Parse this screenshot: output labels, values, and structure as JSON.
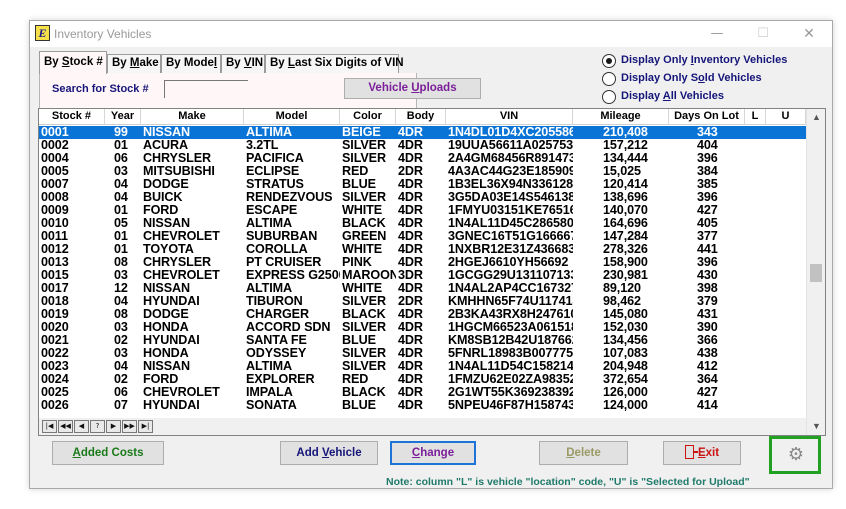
{
  "window": {
    "title": "Inventory Vehicles",
    "controls": {
      "minimize": "—",
      "maximize": "☐",
      "close": "✕"
    }
  },
  "tabs": [
    {
      "prefix": "By ",
      "hot": "S",
      "rest": "tock #",
      "active": true
    },
    {
      "prefix": "By ",
      "hot": "M",
      "rest": "ake",
      "active": false
    },
    {
      "prefix": "By Mode",
      "hot": "l",
      "rest": "",
      "active": false
    },
    {
      "prefix": "By ",
      "hot": "V",
      "rest": "IN",
      "active": false
    },
    {
      "prefix": "By ",
      "hot": "L",
      "rest": "ast Six Digits of VIN",
      "active": false
    }
  ],
  "search": {
    "label": "Search for Stock #",
    "value": ""
  },
  "buttons": {
    "vehicle_uploads": {
      "pre": "Vehicle ",
      "hot": "U",
      "post": "ploads"
    },
    "added_costs": {
      "pre": "",
      "hot": "A",
      "post": "dded Costs"
    },
    "add_vehicle": {
      "pre": "Add ",
      "hot": "V",
      "post": "ehicle"
    },
    "change": {
      "pre": "",
      "hot": "C",
      "post": "hange"
    },
    "delete": {
      "pre": "",
      "hot": "D",
      "post": "elete"
    },
    "exit": {
      "pre": "",
      "hot": "E",
      "post": "xit"
    }
  },
  "radios": [
    {
      "pre": "Display Only ",
      "hot": "I",
      "post": "nventory Vehicles",
      "checked": true
    },
    {
      "pre": "Display Only S",
      "hot": "o",
      "post": "ld Vehicles",
      "checked": false
    },
    {
      "pre": "Display ",
      "hot": "A",
      "post": "ll Vehicles",
      "checked": false
    }
  ],
  "table": {
    "columns": [
      "Stock #",
      "Year",
      "Make",
      "Model",
      "Color",
      "Body",
      "VIN",
      "Mileage",
      "Days On Lot",
      "L",
      "U"
    ],
    "selected_index": 0,
    "rows": [
      [
        "0001",
        "99",
        "NISSAN",
        "ALTIMA",
        "BEIGE",
        "4DR",
        "1N4DL01D4XC205586",
        "210,408",
        "343",
        "",
        ""
      ],
      [
        "0002",
        "01",
        "ACURA",
        "3.2TL",
        "SILVER",
        "4DR",
        "19UUA56611A025753",
        "157,212",
        "404",
        "",
        ""
      ],
      [
        "0004",
        "06",
        "CHRYSLER",
        "PACIFICA",
        "SILVER",
        "4DR",
        "2A4GM68456R891473",
        "134,444",
        "396",
        "",
        ""
      ],
      [
        "0005",
        "03",
        "MITSUBISHI",
        "ECLIPSE",
        "RED",
        "2DR",
        "4A3AC44G23E185909",
        "15,025",
        "384",
        "",
        ""
      ],
      [
        "0007",
        "04",
        "DODGE",
        "STRATUS",
        "BLUE",
        "4DR",
        "1B3EL36X94N336128",
        "120,414",
        "385",
        "",
        ""
      ],
      [
        "0008",
        "04",
        "BUICK",
        "RENDEZVOUS",
        "SILVER",
        "4DR",
        "3G5DA03E14S546138",
        "138,696",
        "396",
        "",
        ""
      ],
      [
        "0009",
        "01",
        "FORD",
        "ESCAPE",
        "WHITE",
        "4DR",
        "1FMYU03151KE76516",
        "140,070",
        "427",
        "",
        ""
      ],
      [
        "0010",
        "05",
        "NISSAN",
        "ALTIMA",
        "BLACK",
        "4DR",
        "1N4AL11D45C286580",
        "164,696",
        "405",
        "",
        ""
      ],
      [
        "0011",
        "01",
        "CHEVROLET",
        "SUBURBAN",
        "GREEN",
        "4DR",
        "3GNEC16T51G166667",
        "147,284",
        "377",
        "",
        ""
      ],
      [
        "0012",
        "01",
        "TOYOTA",
        "COROLLA",
        "WHITE",
        "4DR",
        "1NXBR12E31Z436683",
        "278,326",
        "441",
        "",
        ""
      ],
      [
        "0013",
        "08",
        "CHRYSLER",
        "PT CRUISER",
        "PINK",
        "4DR",
        "2HGEJ6610YH56692",
        "158,900",
        "396",
        "",
        ""
      ],
      [
        "0015",
        "03",
        "CHEVROLET",
        "EXPRESS G2500",
        "MAROON",
        "3DR",
        "1GCGG29U131107133",
        "230,981",
        "430",
        "",
        ""
      ],
      [
        "0017",
        "12",
        "NISSAN",
        "ALTIMA",
        "WHITE",
        "4DR",
        "1N4AL2AP4CC167327",
        "89,120",
        "398",
        "",
        ""
      ],
      [
        "0018",
        "04",
        "HYUNDAI",
        "TIBURON",
        "SILVER",
        "2DR",
        "KMHHN65F74U117413",
        "98,462",
        "379",
        "",
        ""
      ],
      [
        "0019",
        "08",
        "DODGE",
        "CHARGER",
        "BLACK",
        "4DR",
        "2B3KA43RX8H247610",
        "145,080",
        "431",
        "",
        ""
      ],
      [
        "0020",
        "03",
        "HONDA",
        "ACCORD SDN",
        "SILVER",
        "4DR",
        "1HGCM66523A061518",
        "152,030",
        "390",
        "",
        ""
      ],
      [
        "0021",
        "02",
        "HYUNDAI",
        "SANTA FE",
        "BLUE",
        "4DR",
        "KM8SB12B42U187662",
        "134,456",
        "366",
        "",
        ""
      ],
      [
        "0022",
        "03",
        "HONDA",
        "ODYSSEY",
        "SILVER",
        "4DR",
        "5FNRL18983B007775",
        "107,083",
        "438",
        "",
        ""
      ],
      [
        "0023",
        "04",
        "NISSAN",
        "ALTIMA",
        "SILVER",
        "4DR",
        "1N4AL11D54C158214",
        "204,948",
        "412",
        "",
        ""
      ],
      [
        "0024",
        "02",
        "FORD",
        "EXPLORER",
        "RED",
        "4DR",
        "1FMZU62E02ZA98352",
        "372,654",
        "364",
        "",
        ""
      ],
      [
        "0025",
        "06",
        "CHEVROLET",
        "IMPALA",
        "BLACK",
        "4DR",
        "2G1WT55K369238392",
        "126,000",
        "427",
        "",
        ""
      ],
      [
        "0026",
        "07",
        "HYUNDAI",
        "SONATA",
        "BLUE",
        "4DR",
        "5NPEU46F87H158743",
        "124,000",
        "414",
        "",
        ""
      ]
    ]
  },
  "record_navigator": [
    "|◀",
    "◀◀",
    "◀",
    "?",
    "▶",
    "▶▶",
    "▶|"
  ],
  "scrollbar": {
    "up": "▲",
    "down": "▼"
  },
  "settings_icon": "⚙",
  "note": "Note: column \"L\" is vehicle \"location\" code, \"U\" is \"Selected for Upload\"",
  "colors": {
    "selection": "#0a74d6",
    "label_navy": "#15157a",
    "purple": "#7a1f99",
    "green_button": "#1a7a1a",
    "exit_red": "#cc1111",
    "highlight_box": "#21a021",
    "note_teal": "#1f7a6a"
  }
}
